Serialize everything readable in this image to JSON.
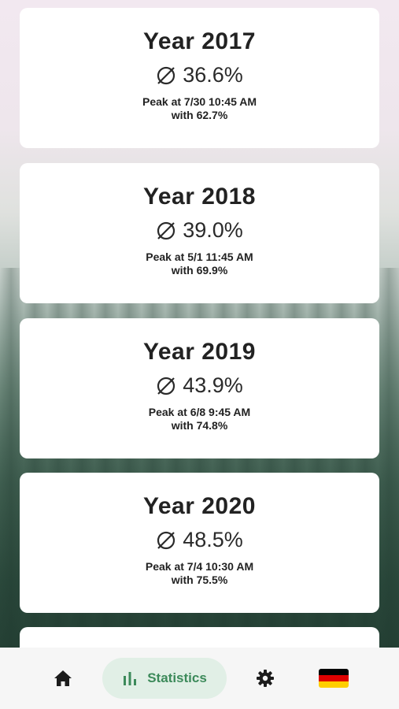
{
  "years": [
    {
      "title": "Year 2017",
      "avg": "36.6%",
      "peak_line1": "Peak at 7/30 10:45 AM",
      "peak_line2": "with 62.7%"
    },
    {
      "title": "Year 2018",
      "avg": "39.0%",
      "peak_line1": "Peak at 5/1 11:45 AM",
      "peak_line2": "with 69.9%"
    },
    {
      "title": "Year 2019",
      "avg": "43.9%",
      "peak_line1": "Peak at 6/8 9:45 AM",
      "peak_line2": "with 74.8%"
    },
    {
      "title": "Year 2020",
      "avg": "48.5%",
      "peak_line1": "Peak at 7/4 10:30 AM",
      "peak_line2": "with 75.5%"
    }
  ],
  "nav": {
    "home_icon": "home-icon",
    "statistics_label": "Statistics",
    "statistics_icon": "bar-chart-icon",
    "settings_icon": "gear-icon",
    "language_icon": "germany-flag-icon"
  },
  "colors": {
    "accent": "#3c8a5a",
    "accent_bg": "#e1efe6",
    "flag_black": "#000000",
    "flag_red": "#dd0000",
    "flag_gold": "#ffce00"
  }
}
